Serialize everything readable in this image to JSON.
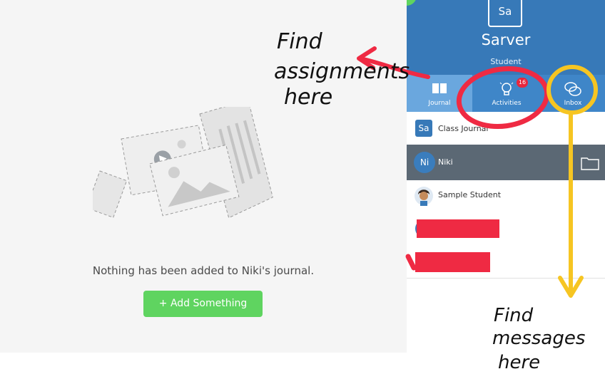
{
  "journal": {
    "empty_message": "Nothing has been added to Niki's journal.",
    "add_button_label": "+ Add Something"
  },
  "sidebar": {
    "avatar_initials": "Sa",
    "name": "Sarver",
    "role": "Student",
    "tabs": [
      {
        "label": "Journal",
        "icon": "book-icon",
        "active": true
      },
      {
        "label": "Activities",
        "icon": "lightbulb-icon",
        "badge": "16",
        "active": false
      },
      {
        "label": "Inbox",
        "icon": "chat-bubbles-icon",
        "active": false
      }
    ],
    "items": [
      {
        "initials": "Sa",
        "label": "Class Journal"
      },
      {
        "initials": "Ni",
        "label": "Niki",
        "selected": true
      },
      {
        "label": "Sample Student",
        "icon": "student-avatar-icon"
      }
    ]
  },
  "annotations": {
    "assignments": [
      "Find",
      "assignments",
      "here"
    ],
    "messages": [
      "Find",
      "messages",
      "here"
    ]
  },
  "colors": {
    "header_blue": "#3779b8",
    "tab_blue": "#3f86c8",
    "selected_row": "#5b6874",
    "add_green": "#5fd460",
    "annotation_red": "#ef2a43",
    "annotation_yellow": "#f6c522"
  }
}
